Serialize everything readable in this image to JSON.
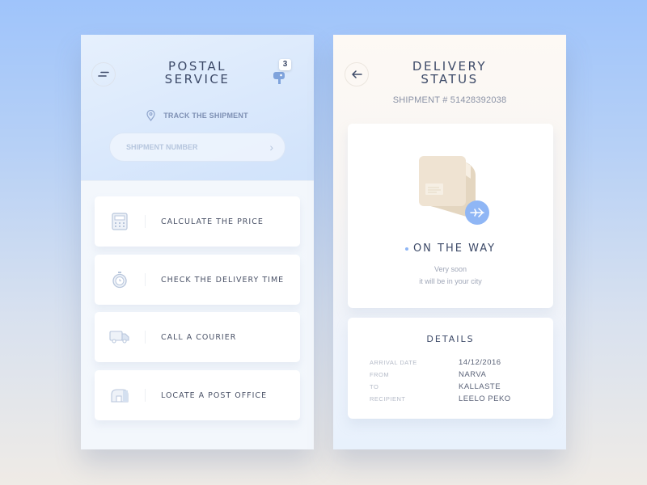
{
  "postal": {
    "title_line1": "POSTAL",
    "title_line2": "SERVICE",
    "menu_icon": "menu-icon",
    "mailbox_icon": "mailbox-icon",
    "notification_count": "3",
    "track_icon": "location-pin-icon",
    "track_label": "TRACK THE SHIPMENT",
    "search": {
      "placeholder": "SHIPMENT NUMBER",
      "value": "",
      "submit_icon": "chevron-right-icon"
    },
    "menu_items": [
      {
        "label": "CALCULATE THE PRICE",
        "icon": "calculator-icon"
      },
      {
        "label": "CHECK THE DELIVERY TIME",
        "icon": "stopwatch-icon"
      },
      {
        "label": "CALL A COURIER",
        "icon": "truck-icon"
      },
      {
        "label": "LOCATE A POST OFFICE",
        "icon": "post-office-icon"
      }
    ]
  },
  "delivery": {
    "back_icon": "arrow-left-icon",
    "title_line1": "DELIVERY",
    "title_line2": "STATUS",
    "shipment_label": "SHIPMENT # 51428392038",
    "illustration": "package-icon",
    "transit_icon": "airplane-icon",
    "status": "ON THE WAY",
    "status_line1": "Very soon",
    "status_line2": "it will be in your city",
    "details_title": "DETAILS",
    "details": [
      {
        "key": "ARRIVAL DATE",
        "value": "14/12/2016"
      },
      {
        "key": "FROM",
        "value": "NARVA"
      },
      {
        "key": "TO",
        "value": "KALLASTE"
      },
      {
        "key": "RECIPIENT",
        "value": "LEELO PEKO"
      }
    ]
  },
  "colors": {
    "accent": "#8fb6f5",
    "title_text": "#3d4a68",
    "package": "#efe3d2"
  }
}
